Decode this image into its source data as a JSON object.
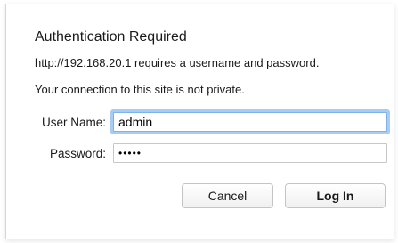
{
  "dialog": {
    "title": "Authentication Required",
    "message": "http://192.168.20.1 requires a username and password.",
    "warning": "Your connection to this site is not private."
  },
  "form": {
    "username_label": "User Name:",
    "username_value": "admin",
    "password_label": "Password:",
    "password_value": "•••••"
  },
  "buttons": {
    "cancel_label": "Cancel",
    "login_label": "Log In"
  },
  "colors": {
    "focus_ring": "#a8cdf5",
    "border": "#c7c7c7"
  }
}
